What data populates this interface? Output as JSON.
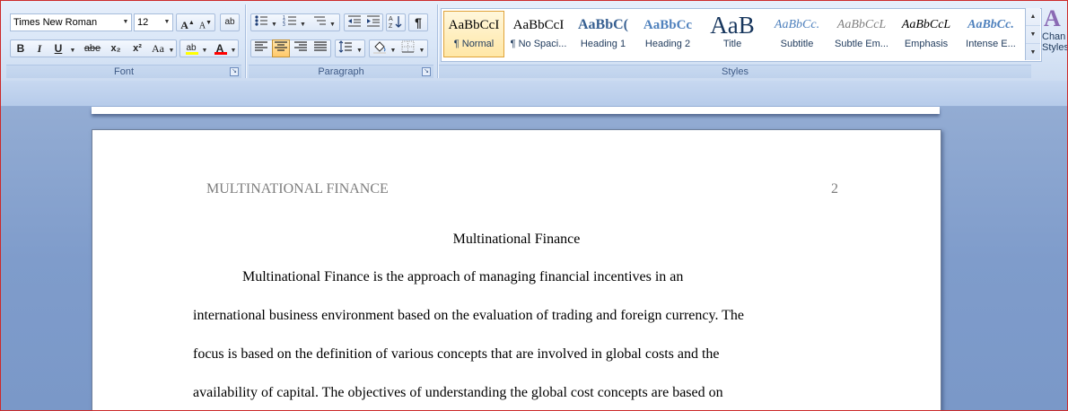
{
  "font": {
    "name_value": "Times New Roman",
    "size_value": "12",
    "grow_label": "A",
    "shrink_label": "A",
    "clear_label": "ab",
    "bold_label": "B",
    "italic_label": "I",
    "underline_label": "U",
    "strike_label": "abe",
    "subscript_label": "x₂",
    "superscript_label": "x²",
    "case_label": "Aa",
    "highlight_label": "ab",
    "color_label": "A",
    "group_label": "Font"
  },
  "paragraph": {
    "group_label": "Paragraph",
    "pilcrow_label": "¶"
  },
  "styles": {
    "group_label": "Styles",
    "items": [
      {
        "sample": "AaBbCcI",
        "label": "¶ Normal"
      },
      {
        "sample": "AaBbCcI",
        "label": "¶ No Spaci..."
      },
      {
        "sample": "AaBbC(",
        "label": "Heading 1"
      },
      {
        "sample": "AaBbCc",
        "label": "Heading 2"
      },
      {
        "sample": "AaB",
        "label": "Title"
      },
      {
        "sample": "AaBbCc.",
        "label": "Subtitle"
      },
      {
        "sample": "AaBbCcL",
        "label": "Subtle Em..."
      },
      {
        "sample": "AaBbCcL",
        "label": "Emphasis"
      },
      {
        "sample": "AaBbCc.",
        "label": "Intense E..."
      }
    ],
    "change_styles_icon": "A",
    "change_styles_label_1": "Chan",
    "change_styles_label_2": "Styles"
  },
  "document": {
    "running_head": "MULTINATIONAL FINANCE",
    "page_number": "2",
    "title": "Multinational Finance",
    "lines": [
      "Multinational Finance is the approach of managing financial incentives in an",
      "international business environment based on the evaluation of trading and foreign currency. The",
      "focus is based on the definition of various concepts that are involved in global costs and the",
      "availability of capital. The objectives of understanding the global cost concepts are based on"
    ]
  },
  "colors": {
    "font_color_bar": "#ff0000",
    "highlight_bar": "#ffff00",
    "accent_selected": "#ffc96b"
  }
}
